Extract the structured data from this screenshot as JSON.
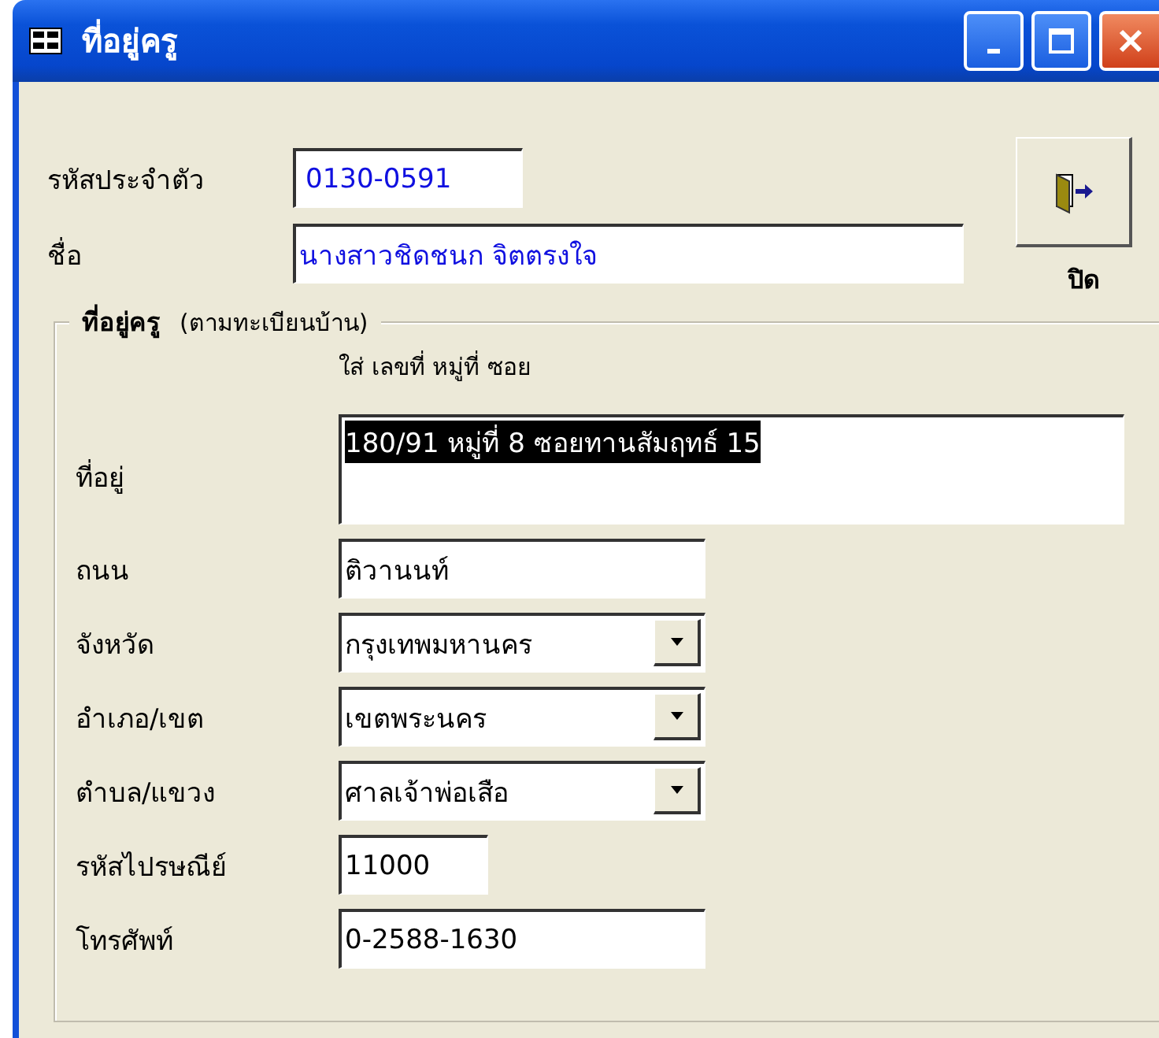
{
  "window": {
    "title": "ที่อยู่ครู"
  },
  "identity": [
    {
      "label": "รหัสประจำตัว",
      "value": "0130-0591",
      "kind": "short"
    },
    {
      "label": "ชื่อ",
      "value": "นางสาวชิดชนก จิตตรงใจ",
      "kind": "long"
    }
  ],
  "close_button": {
    "label": "ปิด"
  },
  "address_group": {
    "title": "ที่อยู่ครู",
    "subtitle": "(ตามทะเบียนบ้าน)",
    "hint": "ใส่ เลขที่ หมู่ที่ ซอย",
    "fields": [
      {
        "kind": "textarea",
        "label": "ที่อยู่",
        "value": "180/91 หมู่ที่ 8 ซอยทานสัมฤทธ์ 15",
        "highlighted": true
      },
      {
        "kind": "text",
        "label": "ถนน",
        "value": "ติวานนท์",
        "highlighted": false
      },
      {
        "kind": "combo",
        "label": "จังหวัด",
        "value": "กรุงเทพมหานคร",
        "highlighted": false
      },
      {
        "kind": "combo",
        "label": "อำเภอ/เขต",
        "value": "เขตพระนคร",
        "highlighted": false
      },
      {
        "kind": "combo",
        "label": "ตำบล/แขวง",
        "value": "ศาลเจ้าพ่อเสือ",
        "highlighted": false
      },
      {
        "kind": "short",
        "label": "รหัสไปรษณีย์",
        "value": "11000",
        "highlighted": false
      },
      {
        "kind": "text",
        "label": "โทรศัพท์",
        "value": "0-2588-1630",
        "highlighted": false
      }
    ]
  }
}
